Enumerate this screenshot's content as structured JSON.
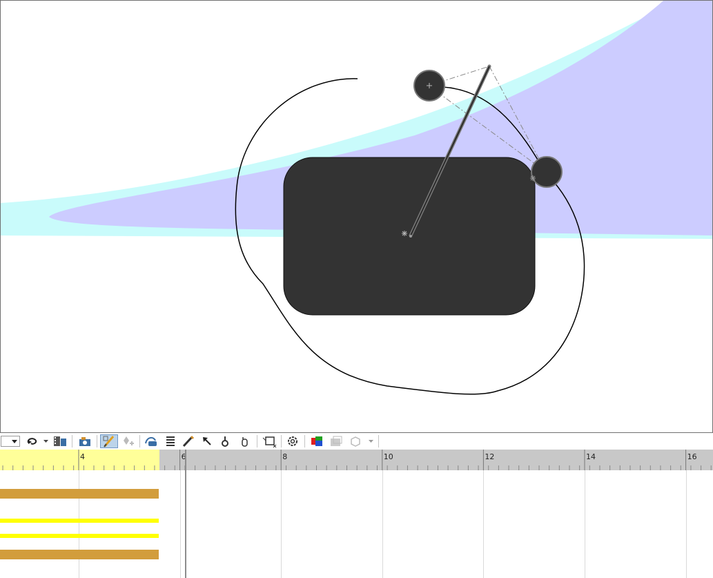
{
  "viewport": {
    "colors": {
      "band_outer": "#c9fbfb",
      "band_inner": "#ccccff",
      "body": "#333333",
      "handle": "#333333",
      "path": "#000000"
    }
  },
  "toolbar": {
    "dropdown_value": "",
    "icons": [
      "dropdown",
      "undo-icon",
      "chevron-down-icon",
      "film-strip-icon",
      "camera-icon",
      "keyframe-edit-icon",
      "add-key-icon",
      "motion-path-icon",
      "layers-icon",
      "pencil-icon",
      "arrow-icon",
      "pin-icon",
      "hand-icon",
      "export-frame-icon",
      "settings-gear-icon",
      "color-cube-icon",
      "render-icon",
      "box-icon",
      "chevron-down-icon"
    ]
  },
  "timeline": {
    "ticks": [
      {
        "label": "4",
        "frame": 4
      },
      {
        "label": "6",
        "frame": 6
      },
      {
        "label": "8",
        "frame": 8
      },
      {
        "label": "10",
        "frame": 10
      },
      {
        "label": "12",
        "frame": 12
      },
      {
        "label": "14",
        "frame": 14
      },
      {
        "label": "16",
        "frame": 16
      }
    ],
    "colors": {
      "highlight": "#ffff99",
      "ruler": "#c8c8c8",
      "bar_orange": "#d29d3c",
      "bar_yellow": "#ffff00"
    },
    "highlight_end_frame": 5.6,
    "playhead_frame": 6.1
  }
}
